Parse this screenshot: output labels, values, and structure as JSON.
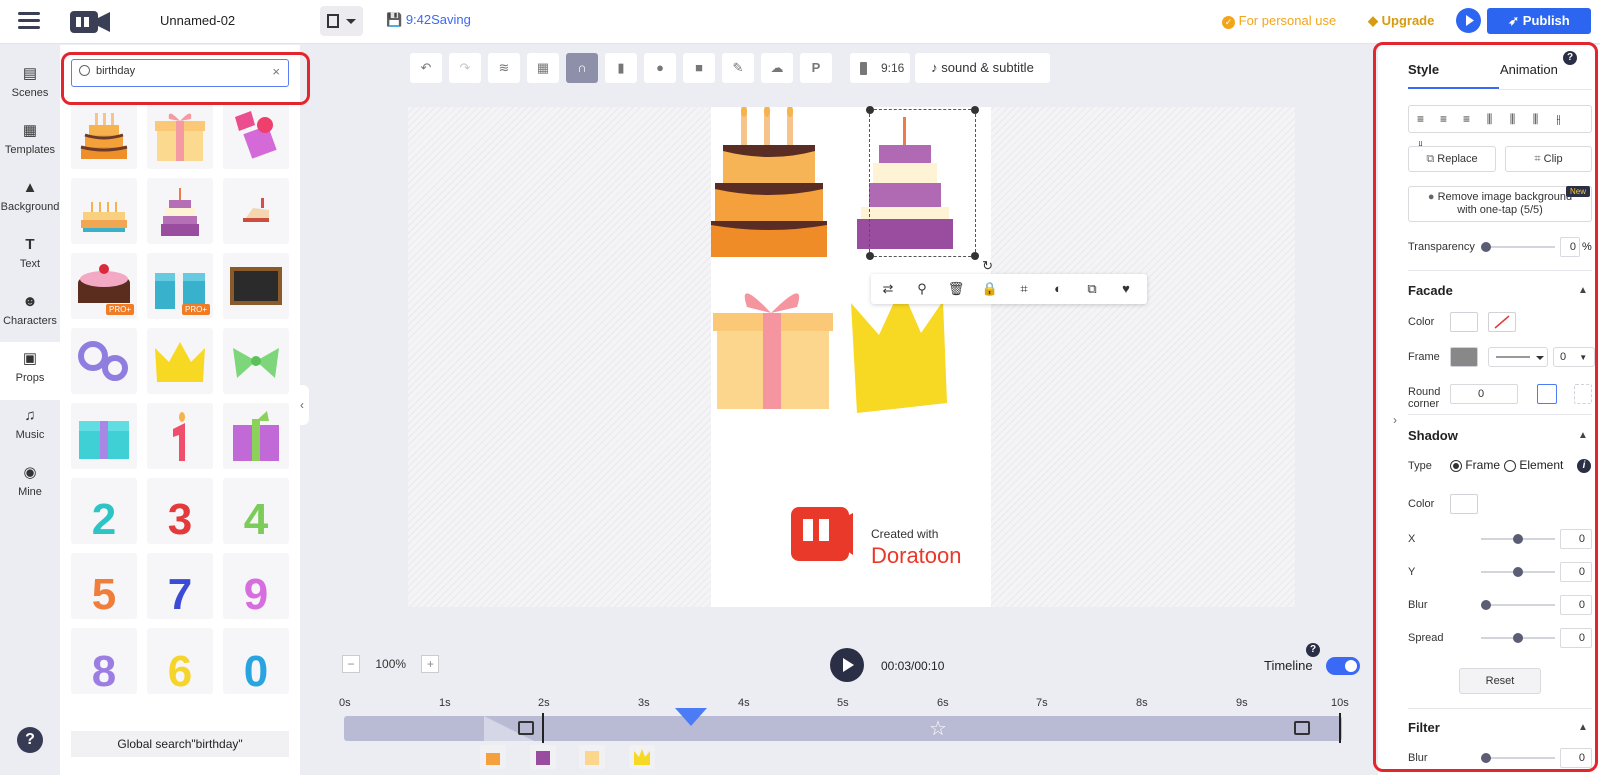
{
  "header": {
    "doc_name": "Unnamed-02",
    "save_status": "9:42Saving",
    "personal_use": "For personal use",
    "upgrade": "Upgrade",
    "publish": "Publish"
  },
  "nav": {
    "items": [
      {
        "label": "Scenes",
        "icon": "scenes-icon"
      },
      {
        "label": "Templates",
        "icon": "templates-icon"
      },
      {
        "label": "Background",
        "icon": "background-icon"
      },
      {
        "label": "Text",
        "icon": "text-icon"
      },
      {
        "label": "Characters",
        "icon": "characters-icon"
      },
      {
        "label": "Props",
        "icon": "props-icon"
      },
      {
        "label": "Music",
        "icon": "music-icon"
      },
      {
        "label": "Mine",
        "icon": "mine-icon"
      }
    ],
    "help": "?"
  },
  "panel": {
    "search_value": "birthday",
    "global_search": "Global search\"birthday\"",
    "pro_badge": "PRO+"
  },
  "toolbar": {
    "ratio": "9:16",
    "sound_subtitle": "sound & subtitle"
  },
  "canvas": {
    "watermark_top": "Created with",
    "watermark_brand": "Doratoon"
  },
  "playback": {
    "zoom": "100%",
    "timecode": "00:03/00:10",
    "timeline_label": "Timeline",
    "ticks": [
      "0s",
      "1s",
      "2s",
      "3s",
      "4s",
      "5s",
      "6s",
      "7s",
      "8s",
      "9s",
      "10s"
    ]
  },
  "right": {
    "tab_style": "Style",
    "tab_animation": "Animation",
    "replace": "Replace",
    "clip": "Clip",
    "remove_bg": "Remove image background with one-tap (5/5)",
    "new_badge": "New",
    "transparency_label": "Transparency",
    "transparency_value": "0",
    "percent": "%",
    "facade": "Facade",
    "color": "Color",
    "frame": "Frame",
    "frame_value": "0",
    "round_corner": "Round corner",
    "round_value": "0",
    "shadow": "Shadow",
    "type": "Type",
    "type_frame": "Frame",
    "type_element": "Element",
    "shadow_color": "Color",
    "x": "X",
    "x_value": "0",
    "y": "Y",
    "y_value": "0",
    "blur": "Blur",
    "blur_value": "0",
    "spread": "Spread",
    "spread_value": "0",
    "reset": "Reset",
    "filter": "Filter",
    "filter_blur": "Blur",
    "filter_blur_value": "0"
  }
}
